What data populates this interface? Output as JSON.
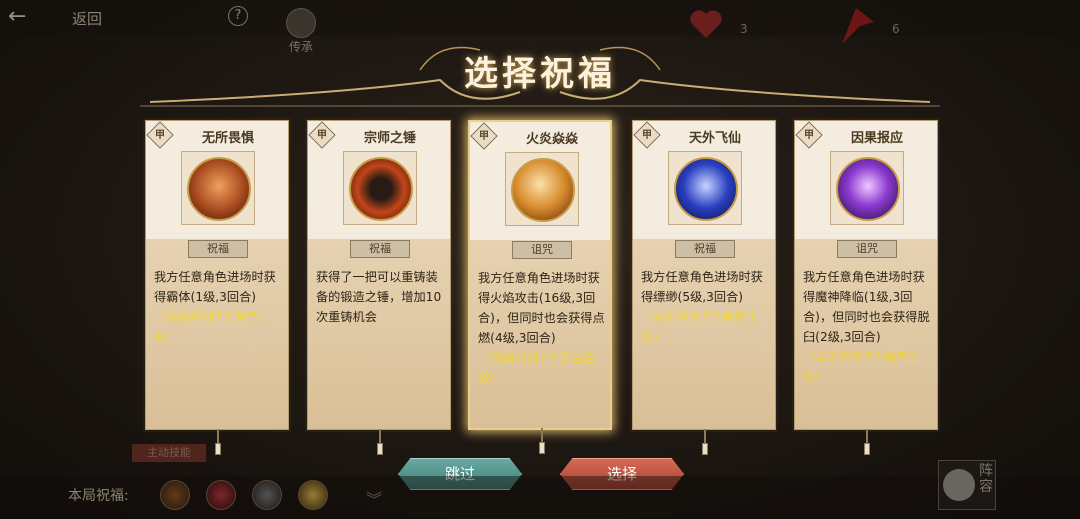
{
  "top": {
    "back_label": "返回",
    "help_symbol": "?",
    "inherit_label": "传承",
    "heart_count": "3",
    "flag_count": "6"
  },
  "dialog": {
    "title": "选择祝福"
  },
  "cards": [
    {
      "badge": "甲",
      "name": "无所畏惧",
      "tag": "祝福",
      "desc": "我方任意角色进场时获得霸体(1级,3回合)",
      "note": "（当前可对7个角色生效）",
      "icon": "warrior-icon",
      "color": "#c0562a",
      "highlight": false
    },
    {
      "badge": "甲",
      "name": "宗师之锤",
      "tag": "祝福",
      "desc": "获得了一把可以重铸装备的锻造之锤，增加10次重铸机会",
      "note": "",
      "icon": "hammer-icon",
      "color": "#b53a16",
      "highlight": false
    },
    {
      "badge": "甲",
      "name": "火炎焱焱",
      "tag": "诅咒",
      "desc": "我方任意角色进场时获得火焰攻击(16级,3回合)，但同时也会获得点燃(4级,3回合)",
      "note": "（当前可对7个角色生效）",
      "icon": "fire-orb-icon",
      "color": "#d88a2c",
      "highlight": true
    },
    {
      "badge": "甲",
      "name": "天外飞仙",
      "tag": "祝福",
      "desc": "我方任意角色进场时获得缥缈(5级,3回合)",
      "note": "（当前可对7个角色生效）",
      "icon": "flying-immortal-icon",
      "color": "#2a3fc0",
      "highlight": false
    },
    {
      "badge": "甲",
      "name": "因果报应",
      "tag": "诅咒",
      "desc": "我方任意角色进场时获得魔神降临(1级,3回合)，但同时也会获得脱臼(2级,3回合)",
      "note": "（当前可对7个角色生效）",
      "icon": "demon-icon",
      "color": "#8a3ad0",
      "highlight": false
    }
  ],
  "buttons": {
    "skip": "跳过",
    "select": "选择"
  },
  "bottom": {
    "blessing_label": "本局祝福:",
    "skill_tag": "主动技能",
    "lineup_label": "阵容",
    "chevron": "︾"
  }
}
